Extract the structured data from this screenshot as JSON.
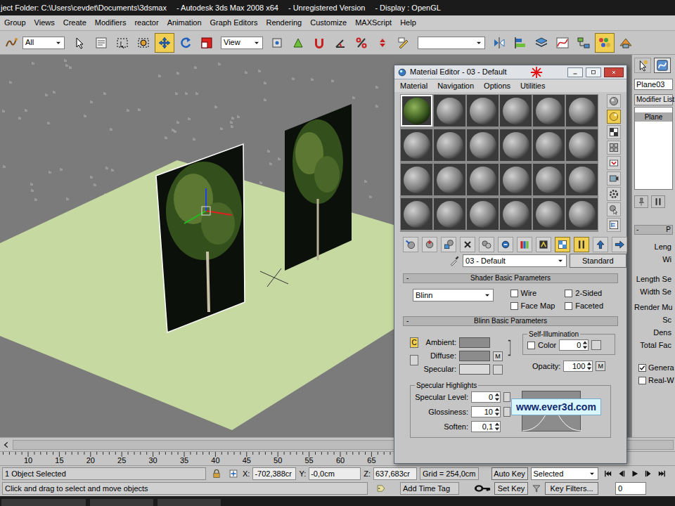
{
  "window": {
    "title_parts": [
      "ject Folder: C:\\Users\\cevdet\\Documents\\3dsmax",
      "- Autodesk 3ds Max 2008 x64",
      "- Unregistered Version",
      "- Display : OpenGL"
    ]
  },
  "menu": [
    "Group",
    "Views",
    "Create",
    "Modifiers",
    "reactor",
    "Animation",
    "Graph Editors",
    "Rendering",
    "Customize",
    "MAXScript",
    "Help"
  ],
  "toolbar": {
    "tools_a": [
      {
        "kind": "bind",
        "selected": false
      }
    ],
    "selection_filter": "All",
    "tools_b": [
      {
        "kind": "select",
        "selected": false
      },
      {
        "kind": "select-name",
        "selected": false
      },
      {
        "kind": "region",
        "selected": false
      },
      {
        "kind": "crossing",
        "selected": false
      },
      {
        "kind": "move",
        "selected": true
      },
      {
        "kind": "rotate",
        "selected": false
      },
      {
        "kind": "scale",
        "selected": false
      }
    ],
    "reference_coord": "View",
    "tools_c": [
      {
        "kind": "pivot",
        "selected": false
      },
      {
        "kind": "manipulate",
        "selected": false
      },
      {
        "kind": "snap",
        "selected": false
      },
      {
        "kind": "angle-snap",
        "selected": false
      },
      {
        "kind": "percent-snap",
        "selected": false
      },
      {
        "kind": "spinner-snap",
        "selected": false
      },
      {
        "kind": "named-sel",
        "selected": false
      }
    ],
    "tools_d": [
      {
        "kind": "mirror",
        "selected": false
      },
      {
        "kind": "align",
        "selected": false
      },
      {
        "kind": "layers",
        "selected": false
      },
      {
        "kind": "curve",
        "selected": false
      },
      {
        "kind": "schematic",
        "selected": false
      },
      {
        "kind": "material",
        "selected": true
      },
      {
        "kind": "render-setup",
        "selected": false
      }
    ]
  },
  "command_panel": {
    "tabs": [
      {
        "kind": "create",
        "selected": false
      },
      {
        "kind": "modify",
        "selected": true
      }
    ],
    "object_name": "Plane03",
    "modifier_list": "Modifier List",
    "stack": [
      {
        "label": "Plane",
        "selected": true
      }
    ],
    "rollout": {
      "toggle": "-",
      "title": "P"
    },
    "params": [
      "Leng",
      "Wi"
    ],
    "segments": [
      "Length Se",
      "Width Se"
    ],
    "render_group": "Render Mu",
    "render_params": [
      "Sc",
      "Dens",
      "Total Fac"
    ],
    "options": [
      {
        "label": "Genera",
        "checked": true
      },
      {
        "label": "Real-W",
        "checked": false
      }
    ]
  },
  "timeline": {
    "ruler": [
      "10",
      "15",
      "20",
      "25",
      "30",
      "35",
      "40",
      "45",
      "50",
      "55",
      "60",
      "65"
    ]
  },
  "status": {
    "selection": "1 Object Selected",
    "prompt": "Click and drag to select and move objects",
    "coords": [
      {
        "axis": "X:",
        "value": "-702,388cr"
      },
      {
        "axis": "Y:",
        "value": "-0,0cm"
      },
      {
        "axis": "Z:",
        "value": "637,683cr"
      }
    ],
    "grid": "Grid = 254,0cm",
    "auto_key": {
      "label": "Auto Key",
      "on": false
    },
    "key_mode": "Selected",
    "set_key": "Set Key",
    "key_filters": "Key Filters...",
    "time_tag": "Add Time Tag",
    "frame": "0"
  },
  "material_editor": {
    "title": "Material Editor - 03 - Default",
    "menu": [
      "Material",
      "Navigation",
      "Options",
      "Utilities"
    ],
    "slots": [
      {
        "kind": "textured",
        "selected": true
      },
      {
        "kind": "default",
        "selected": false
      },
      {
        "kind": "default",
        "selected": false
      },
      {
        "kind": "default",
        "selected": false
      },
      {
        "kind": "default",
        "selected": false
      },
      {
        "kind": "default",
        "selected": false
      },
      {
        "kind": "default",
        "selected": false
      },
      {
        "kind": "default",
        "selected": false
      },
      {
        "kind": "default",
        "selected": false
      },
      {
        "kind": "default",
        "selected": false
      },
      {
        "kind": "default",
        "selected": false
      },
      {
        "kind": "default",
        "selected": false
      },
      {
        "kind": "default",
        "selected": false
      },
      {
        "kind": "default",
        "selected": false
      },
      {
        "kind": "default",
        "selected": false
      },
      {
        "kind": "default",
        "selected": false
      },
      {
        "kind": "default",
        "selected": false
      },
      {
        "kind": "default",
        "selected": false
      },
      {
        "kind": "default",
        "selected": false
      },
      {
        "kind": "default",
        "selected": false
      },
      {
        "kind": "default",
        "selected": false
      },
      {
        "kind": "default",
        "selected": false
      },
      {
        "kind": "default",
        "selected": false
      },
      {
        "kind": "default",
        "selected": false
      }
    ],
    "side_tools": [
      {
        "kind": "sphere",
        "selected": false
      },
      {
        "kind": "backlight",
        "selected": true
      },
      {
        "kind": "checker",
        "selected": false
      },
      {
        "kind": "tiling",
        "selected": false
      },
      {
        "kind": "video",
        "selected": false
      },
      {
        "kind": "preview",
        "selected": false
      },
      {
        "kind": "options",
        "selected": false
      },
      {
        "kind": "select-by-mat",
        "selected": false
      },
      {
        "kind": "navigator",
        "selected": false
      }
    ],
    "bottom_tools": [
      {
        "kind": "get",
        "selected": false
      },
      {
        "kind": "put-scene",
        "selected": false
      },
      {
        "kind": "assign",
        "selected": false
      },
      {
        "kind": "reset",
        "selected": false
      },
      {
        "kind": "copy",
        "selected": false
      },
      {
        "kind": "unique",
        "selected": false
      },
      {
        "kind": "library",
        "selected": false
      },
      {
        "kind": "effects",
        "selected": false
      },
      {
        "kind": "show-map",
        "selected": true
      },
      {
        "kind": "show-end",
        "selected": true
      },
      {
        "kind": "parent",
        "selected": false
      },
      {
        "kind": "sibling",
        "selected": false
      }
    ],
    "material_name": "03 - Default",
    "material_type": "Standard",
    "shader_rollout": {
      "toggle": "-",
      "title": "Shader Basic Parameters",
      "shader": "Blinn",
      "options": [
        {
          "label": "Wire",
          "checked": false
        },
        {
          "label": "2-Sided",
          "checked": false
        },
        {
          "label": "Face Map",
          "checked": false
        },
        {
          "label": "Faceted",
          "checked": false
        }
      ]
    },
    "basic_rollout": {
      "toggle": "-",
      "title": "Blinn Basic Parameters",
      "lock_label": "C",
      "colors": [
        {
          "label": "Ambient:",
          "color": "#8c8c8c",
          "kind": "plain"
        },
        {
          "label": "Diffuse:",
          "color": "#8c8c8c",
          "kind": "mapped",
          "map": "M"
        },
        {
          "label": "Specular:",
          "color": "#dadada",
          "kind": "slot"
        }
      ],
      "self_illum": {
        "title": "Self-Illumination",
        "label": "Color",
        "checked": false,
        "value": "0"
      },
      "opacity": {
        "label": "Opacity:",
        "value": "100",
        "map": "M"
      }
    },
    "specular": {
      "title": "Specular Highlights",
      "fields": [
        {
          "label": "Specular Level:",
          "value": "0",
          "kind": "mapped"
        },
        {
          "label": "Glossiness:",
          "value": "10",
          "kind": "mapped"
        },
        {
          "label": "Soften:",
          "value": "0,1",
          "kind": "plain"
        }
      ]
    },
    "watermark": "www.ever3d.com"
  }
}
